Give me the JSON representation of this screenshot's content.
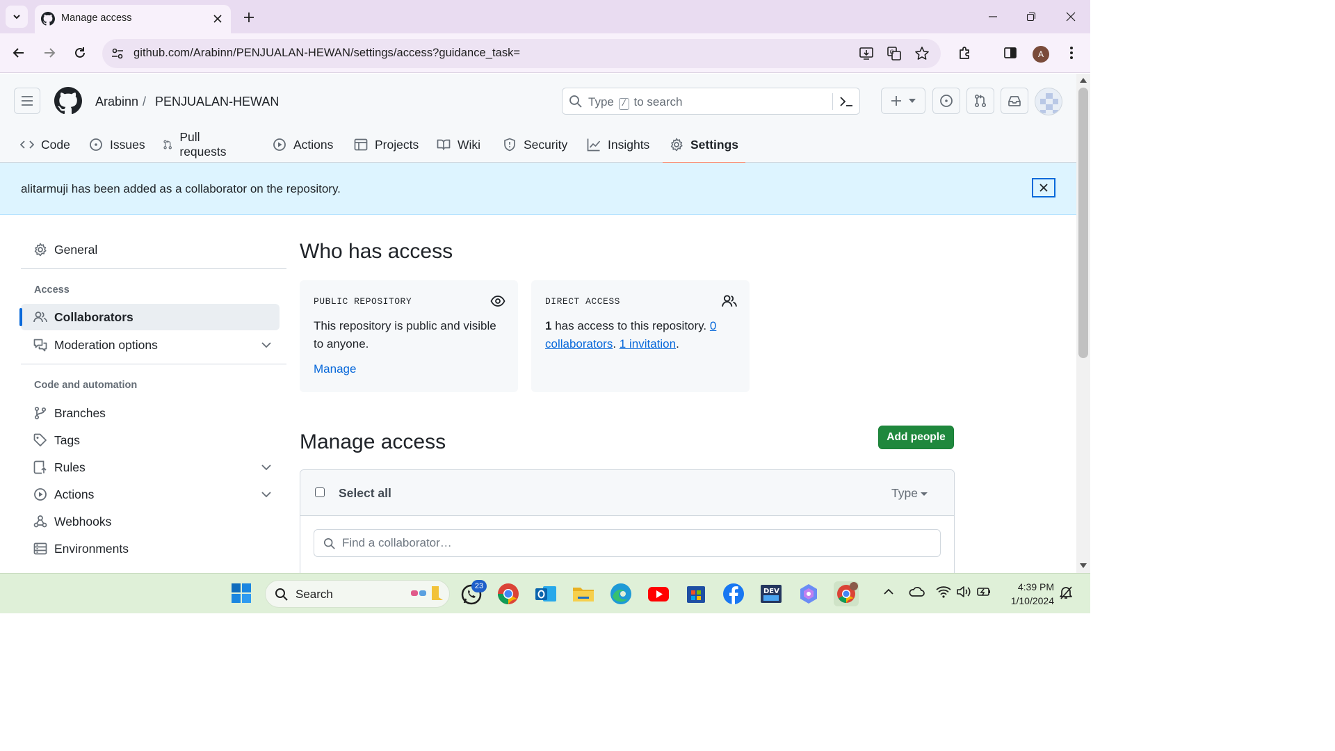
{
  "browser": {
    "tab_title": "Manage access",
    "url": "github.com/Arabinn/PENJUALAN-HEWAN/settings/access?guidance_task=",
    "profile_initial": "A"
  },
  "header": {
    "owner": "Arabinn",
    "separator": "/",
    "repo": "PENJUALAN-HEWAN",
    "search_type": "Type",
    "search_key": "/",
    "search_rest": "to search"
  },
  "repo_nav": {
    "code": "Code",
    "issues": "Issues",
    "pulls": "Pull requests",
    "actions": "Actions",
    "projects": "Projects",
    "wiki": "Wiki",
    "security": "Security",
    "insights": "Insights",
    "settings": "Settings"
  },
  "flash": {
    "message": "alitarmuji has been added as a collaborator on the repository."
  },
  "sidebar": {
    "general": "General",
    "access_heading": "Access",
    "collaborators": "Collaborators",
    "moderation": "Moderation options",
    "code_heading": "Code and automation",
    "branches": "Branches",
    "tags": "Tags",
    "rules": "Rules",
    "actions": "Actions",
    "webhooks": "Webhooks",
    "environments": "Environments"
  },
  "who_has_access": {
    "title": "Who has access",
    "public_caption": "PUBLIC REPOSITORY",
    "public_body": "This repository is public and visible to anyone.",
    "manage_link": "Manage",
    "direct_caption": "DIRECT ACCESS",
    "direct_count": "1",
    "direct_text": " has access to this repository. ",
    "collaborators_link": "0 collaborators",
    "sep": ". ",
    "invitation_link": "1 invitation",
    "end": "."
  },
  "manage_access": {
    "title": "Manage access",
    "add_button": "Add people",
    "select_all": "Select all",
    "type_filter": "Type",
    "find_placeholder": "Find a collaborator…"
  },
  "taskbar": {
    "search_label": "Search",
    "whatsapp_badge": "23",
    "time": "4:39 PM",
    "date": "1/10/2024"
  },
  "colors": {
    "accent": "#0969da",
    "primary_button": "#1f883d",
    "flash_bg": "#ddf4ff",
    "selected_tab_underline": "#fd8c73"
  }
}
